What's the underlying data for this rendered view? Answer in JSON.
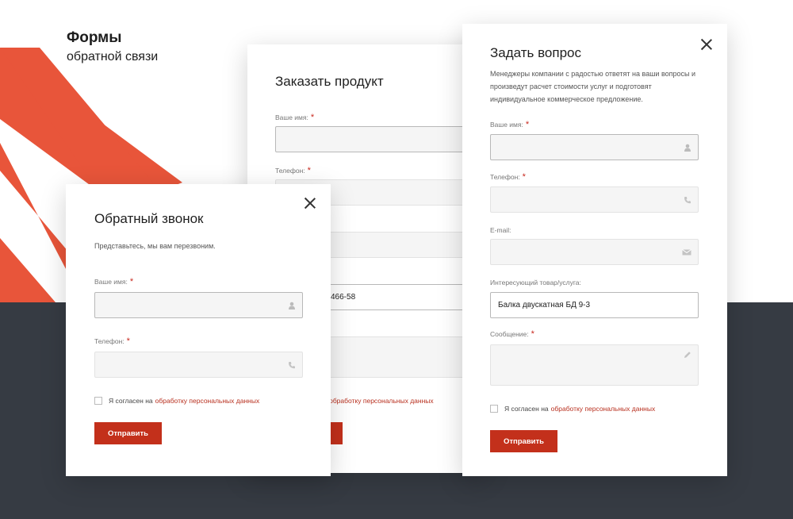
{
  "header": {
    "title": "Формы",
    "subtitle": "обратной связи"
  },
  "colors": {
    "accent": "#c3301b",
    "stripe": "#e8553a",
    "dark_band": "#363b43"
  },
  "order_form": {
    "title": "Заказать продукт",
    "name_label": "Ваше имя:",
    "phone_label": "Телефон:",
    "phone_fragment": "466-58",
    "agree_link_fragment": "а обработку персональных данных"
  },
  "callback_form": {
    "title": "Обратный звонок",
    "description": "Представьтесь, мы вам перезвоним.",
    "name_label": "Ваше имя:",
    "phone_label": "Телефон:",
    "agree_text": "Я согласен на",
    "agree_link": "обработку персональных данных",
    "submit_label": "Отправить"
  },
  "question_form": {
    "title": "Задать вопрос",
    "description_lines": [
      "Менеджеры компании с радостью ответят на ваши вопросы и",
      "произведут расчет стоимости услуг и подготовят",
      "индивидуальное коммерческое предложение."
    ],
    "name_label": "Ваше имя:",
    "phone_label": "Телефон:",
    "email_label": "E-mail:",
    "product_label": "Интересующий товар/услуга:",
    "product_value": "Балка двускатная БД 9-3",
    "message_label": "Сообщение:",
    "agree_text": "Я согласен на",
    "agree_link": "обработку персональных данных",
    "submit_label": "Отправить"
  },
  "required_mark": "*",
  "icons": [
    "user-icon",
    "phone-icon",
    "mail-icon",
    "pencil-icon",
    "close-icon"
  ]
}
